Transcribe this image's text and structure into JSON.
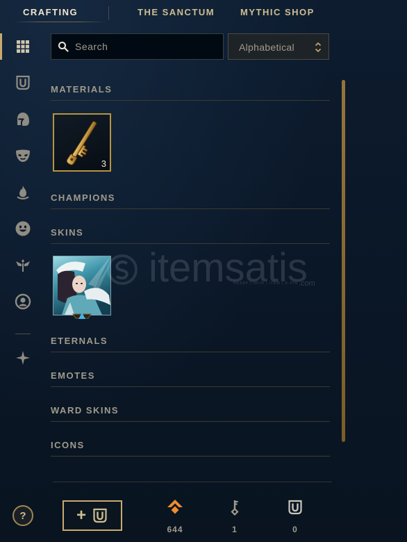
{
  "nav": {
    "tabs": [
      {
        "label": "CRAFTING",
        "active": true
      },
      {
        "label": "THE SANCTUM",
        "active": false
      },
      {
        "label": "MYTHIC SHOP",
        "active": false
      }
    ]
  },
  "sidebar": {
    "items": [
      {
        "icon": "grid-icon",
        "active": true
      },
      {
        "icon": "chest-icon",
        "active": false
      },
      {
        "icon": "helmet-icon",
        "active": false
      },
      {
        "icon": "mask-icon",
        "active": false
      },
      {
        "icon": "flame-icon",
        "active": false
      },
      {
        "icon": "emote-icon",
        "active": false
      },
      {
        "icon": "ward-icon",
        "active": false
      },
      {
        "icon": "profile-icon",
        "active": false
      },
      {
        "icon": "star-icon",
        "active": false
      }
    ]
  },
  "search": {
    "placeholder": "Search",
    "value": "",
    "icon": "search-icon"
  },
  "sort": {
    "selected": "Alphabetical",
    "icon": "up-down-chevron-icon"
  },
  "sections": [
    {
      "title": "MATERIALS",
      "items": [
        {
          "icon": "key-fragment-icon",
          "count": "3"
        }
      ]
    },
    {
      "title": "CHAMPIONS",
      "items": []
    },
    {
      "title": "SKINS",
      "items": [
        {
          "icon": "skin-shard-image"
        }
      ]
    },
    {
      "title": "ETERNALS",
      "items": []
    },
    {
      "title": "EMOTES",
      "items": []
    },
    {
      "title": "WARD SKINS",
      "items": []
    },
    {
      "title": "ICONS",
      "items": []
    }
  ],
  "footer": {
    "help_label": "?",
    "craft_button": {
      "label": "+",
      "icon": "chest-icon"
    },
    "currencies": [
      {
        "icon": "orange-essence-icon",
        "value": "644"
      },
      {
        "icon": "key-icon",
        "value": "1"
      },
      {
        "icon": "chest-icon",
        "value": "0"
      }
    ]
  },
  "watermark": {
    "text": "itemsatis",
    "tagline": "HESAP | SKIN | İTEM | E-PİN",
    "domain": ".com"
  },
  "colors": {
    "background": "#0b1829",
    "gold": "#c8aa6e",
    "text_bright": "#f0e6d2",
    "text_muted": "#a09b8c",
    "essence_orange": "#f08c2e",
    "rarity_blue": "#3fb6e8"
  }
}
